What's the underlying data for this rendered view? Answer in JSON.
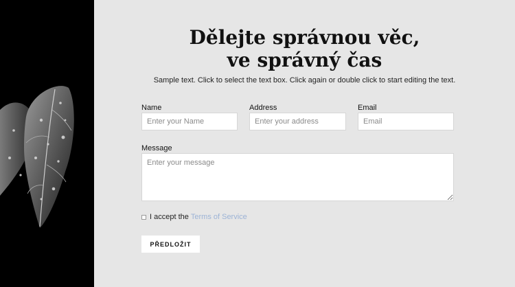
{
  "heading": {
    "line1": "Dělejte správnou věc,",
    "line2": "ve správný čas"
  },
  "subtitle": "Sample text. Click to select the text box. Click again or double click to start editing the text.",
  "form": {
    "name": {
      "label": "Name",
      "placeholder": "Enter your Name"
    },
    "address": {
      "label": "Address",
      "placeholder": "Enter your address"
    },
    "email": {
      "label": "Email",
      "placeholder": "Email"
    },
    "message": {
      "label": "Message",
      "placeholder": "Enter your message"
    },
    "consent": {
      "text": "I accept the",
      "link": "Terms of Service"
    },
    "submit": "PŘEDLOŽIT"
  },
  "colors": {
    "background": "#e6e6e6",
    "left_panel": "#000000",
    "link": "#9cb3d6"
  }
}
